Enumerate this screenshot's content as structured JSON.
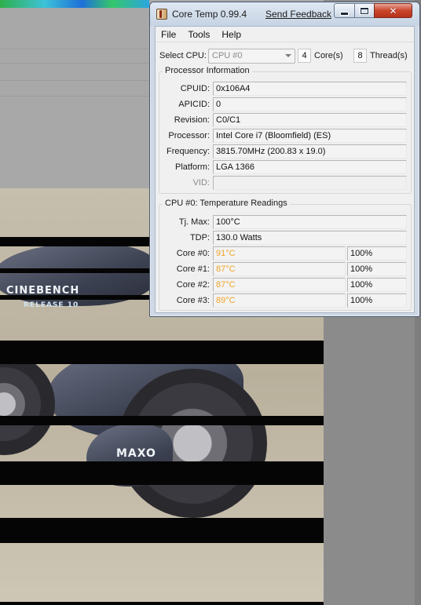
{
  "window": {
    "title": "Core Temp 0.99.4",
    "feedback_link": "Send Feedback",
    "controls": {
      "minimize": "minimize",
      "maximize": "maximize",
      "close": "✕"
    }
  },
  "menu": [
    "File",
    "Tools",
    "Help"
  ],
  "cpu_select": {
    "label": "Select CPU:",
    "value": "CPU #0",
    "cores_value": "4",
    "cores_label": "Core(s)",
    "threads_value": "8",
    "threads_label": "Thread(s)"
  },
  "processor_info": {
    "title": "Processor Information",
    "rows": [
      {
        "label": "CPUID:",
        "value": "0x106A4"
      },
      {
        "label": "APICID:",
        "value": "0"
      },
      {
        "label": "Revision:",
        "value": "C0/C1"
      },
      {
        "label": "Processor:",
        "value": "Intel Core i7 (Bloomfield) (ES)"
      },
      {
        "label": "Frequency:",
        "value": "3815.70MHz (200.83 x 19.0)"
      },
      {
        "label": "Platform:",
        "value": "LGA 1366"
      },
      {
        "label": "VID:",
        "value": ""
      }
    ]
  },
  "temps": {
    "title": "CPU #0: Temperature Readings",
    "tj_max": {
      "label": "Tj. Max:",
      "value": "100°C"
    },
    "tdp": {
      "label": "TDP:",
      "value": "130.0 Watts"
    },
    "cores": [
      {
        "label": "Core #0:",
        "temp": "91°C",
        "load": "100%"
      },
      {
        "label": "Core #1:",
        "temp": "87°C",
        "load": "100%"
      },
      {
        "label": "Core #2:",
        "temp": "87°C",
        "load": "100%"
      },
      {
        "label": "Core #3:",
        "temp": "89°C",
        "load": "100%"
      }
    ]
  },
  "background": {
    "logo1": "CINEBENCH",
    "logo2": "RELEASE 10",
    "logo3": "MAXO"
  },
  "colors": {
    "hot_temp": "#f1a42a",
    "title_bar": "#cfd8e4",
    "close_button": "#c9462c"
  }
}
